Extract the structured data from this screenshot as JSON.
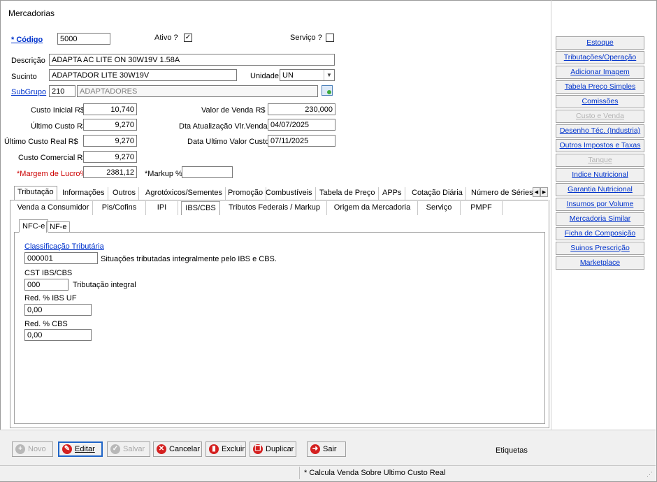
{
  "window": {
    "title": "Mercadorias"
  },
  "form": {
    "codigo_label": "* Código",
    "codigo_value": "5000",
    "ativo_label": "Ativo ?",
    "ativo_checked": "✓",
    "servico_label": "Serviço ?",
    "descricao_label": "Descrição",
    "descricao_value": "ADAPTA AC LITE ON 30W19V 1.58A",
    "sucinto_label": "Sucinto",
    "sucinto_value": "ADAPTADOR LITE 30W19V",
    "unidade_label": "Unidade",
    "unidade_value": "UN",
    "subgrupo_label": "SubGrupo",
    "subgrupo_code": "210",
    "subgrupo_name": "ADAPTADORES",
    "custo_inicial_label": "Custo Inicial R$",
    "custo_inicial_value": "10,740",
    "ultimo_custo_label": "Último Custo R$",
    "ultimo_custo_value": "9,270",
    "ultimo_custo_real_label": "Último Custo Real R$",
    "ultimo_custo_real_value": "9,270",
    "custo_comercial_label": "Custo Comercial R$",
    "custo_comercial_value": "9,270",
    "margem_label": "*Margem de Lucro%",
    "margem_value": "2381,12",
    "markup_label": "*Markup %",
    "markup_value": "",
    "valor_venda_label": "Valor de Venda R$",
    "valor_venda_value": "230,000",
    "dta_atualizacao_label": "Dta Atualização Vlr.Venda",
    "dta_atualizacao_value": "04/07/2025",
    "data_ultimo_custo_label": "Data Ultimo Valor Custo",
    "data_ultimo_custo_value": "07/11/2025"
  },
  "sidebar": {
    "items": [
      {
        "label": "Estoque"
      },
      {
        "label": "Tributações/Operação"
      },
      {
        "label": "Adicionar Imagem"
      },
      {
        "label": "Tabela Preço Simples"
      },
      {
        "label": "Comissões"
      },
      {
        "label": "Custo e Venda"
      },
      {
        "label": "Desenho Téc. (Industria)"
      },
      {
        "label": "Outros Impostos e Taxas"
      },
      {
        "label": "Tanque"
      },
      {
        "label": "Indice Nutricional"
      },
      {
        "label": "Garantia Nutricional"
      },
      {
        "label": "Insumos por Volume"
      },
      {
        "label": "Mercadoria Similar"
      },
      {
        "label": "Ficha de Composição"
      },
      {
        "label": "Suinos Prescrição"
      },
      {
        "label": "Marketplace"
      }
    ]
  },
  "tabs_main": [
    {
      "label": "Tributação"
    },
    {
      "label": "Informações"
    },
    {
      "label": "Outros"
    },
    {
      "label": "Agrotóxicos/Sementes"
    },
    {
      "label": "Promoção"
    },
    {
      "label": "Combustíveis"
    },
    {
      "label": "Tabela de Preço"
    },
    {
      "label": "APPs"
    },
    {
      "label": "Cotação Diária"
    },
    {
      "label": "Número de Séries"
    }
  ],
  "tabs_sub": [
    {
      "label": "Venda a Consumidor"
    },
    {
      "label": "Pis/Cofins"
    },
    {
      "label": "IPI"
    },
    {
      "label": "IBS/CBS"
    },
    {
      "label": "Tributos Federais / Markup"
    },
    {
      "label": "Origem da Mercadoria"
    },
    {
      "label": "Serviço"
    },
    {
      "label": "PMPF"
    }
  ],
  "tabs_nf": [
    {
      "label": "NFC-e"
    },
    {
      "label": "NF-e"
    }
  ],
  "ibs": {
    "classificacao_label": "Classificação Tributária",
    "classificacao_value": "000001",
    "classificacao_desc": "Situações tributadas integralmente pelo IBS e CBS.",
    "cst_label": "CST IBS/CBS",
    "cst_value": "000",
    "cst_desc": "Tributação integral",
    "red_ibs_label": "Red. % IBS UF",
    "red_ibs_value": "0,00",
    "red_cbs_label": "Red. % CBS",
    "red_cbs_value": "0,00"
  },
  "toolbar": {
    "novo": "Novo",
    "editar": "Editar",
    "salvar": "Salvar",
    "cancelar": "Cancelar",
    "excluir": "Excluir",
    "duplicar": "Duplicar",
    "sair": "Sair",
    "etiquetas": "Etiquetas"
  },
  "status": {
    "text": "* Calcula Venda Sobre Ultimo Custo  Real"
  }
}
